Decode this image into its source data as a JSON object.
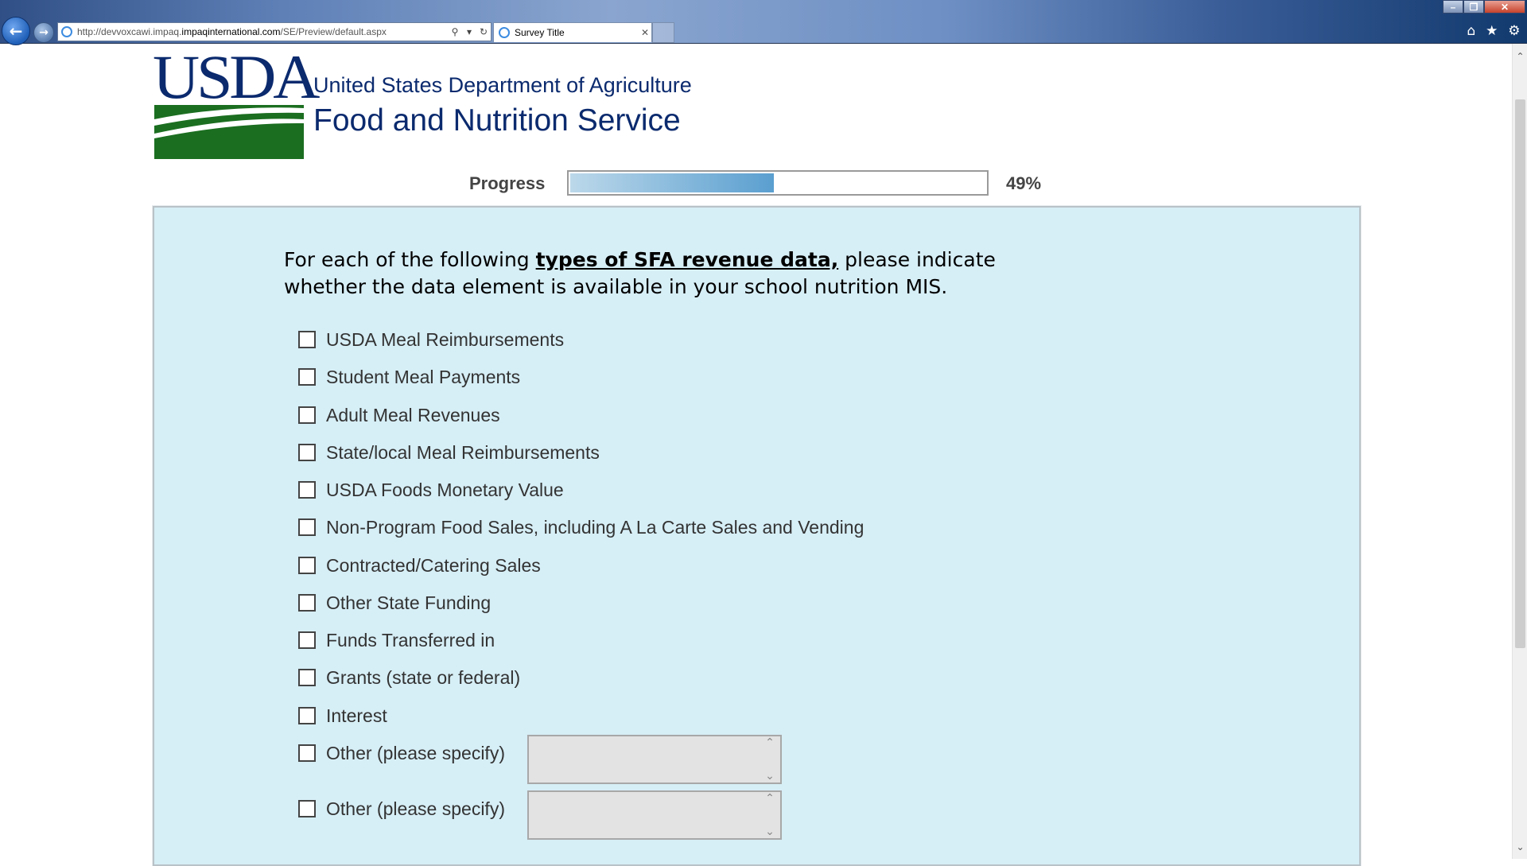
{
  "browser": {
    "url_prefix": "http://devvoxcawi.impaq.",
    "url_domain": "impaqinternational.com",
    "url_path": "/SE/Preview/default.aspx",
    "tab_title": "Survey Title"
  },
  "header": {
    "logo_text": "USDA",
    "agency_line1": "United States Department of Agriculture",
    "agency_line2": "Food and Nutrition Service"
  },
  "progress": {
    "label": "Progress",
    "percent": 49,
    "percent_text": "49%"
  },
  "question": {
    "text_before": "For each of the following ",
    "text_emphasis": "types of SFA revenue data,",
    "text_after": " please indicate whether the data element is available in your school nutrition MIS."
  },
  "options": [
    {
      "label": "USDA Meal Reimbursements",
      "checked": false
    },
    {
      "label": "Student Meal Payments",
      "checked": false
    },
    {
      "label": "Adult Meal Revenues",
      "checked": false
    },
    {
      "label": "State/local Meal Reimbursements",
      "checked": false
    },
    {
      "label": "USDA Foods Monetary Value",
      "checked": false
    },
    {
      "label": "Non-Program Food Sales, including A La Carte Sales and Vending",
      "checked": false
    },
    {
      "label": "Contracted/Catering Sales",
      "checked": false
    },
    {
      "label": "Other State Funding",
      "checked": false
    },
    {
      "label": "Funds Transferred in",
      "checked": false
    },
    {
      "label": "Grants (state or federal)",
      "checked": false
    },
    {
      "label": "Interest",
      "checked": false
    },
    {
      "label": "Other (please specify)",
      "checked": false,
      "specify_value": ""
    },
    {
      "label": "Other (please specify)",
      "checked": false,
      "specify_value": ""
    }
  ],
  "colors": {
    "usda_blue": "#0b2a6e",
    "usda_green": "#1b6e20",
    "panel_bg": "#d6eef6",
    "progress_fill": "#5a9fd0"
  }
}
